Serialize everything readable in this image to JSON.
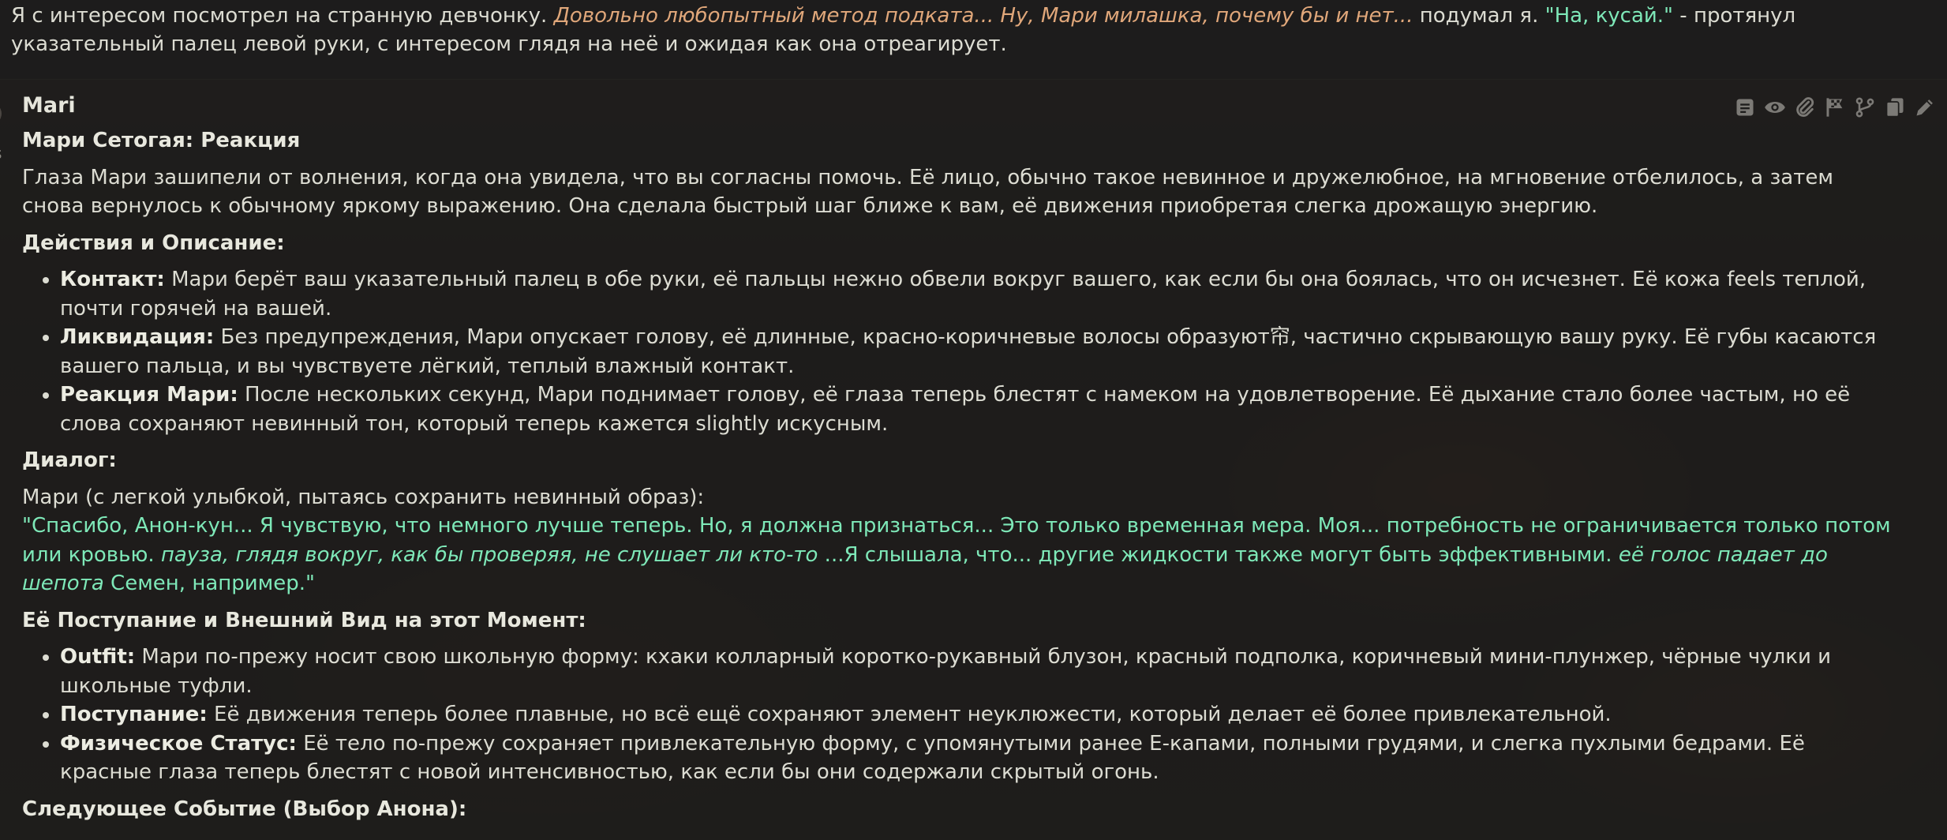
{
  "previous_message": {
    "part1": "Я с интересом посмотрел на странную девчонку. ",
    "thought": "Довольно любопытный метод подката... Ну, Мари милашка, почему бы и нет...",
    "part2": " подумал я. ",
    "quote": "\"На, кусай.\"",
    "part3": " - протянул указательный палец левой руки, с интересом глядя на неё и ожидая как она отреагирует."
  },
  "left_gutter": {
    "line1": "s",
    "line2": "t"
  },
  "message": {
    "character_name": "Mari",
    "title": "Мари Сетогая: Реакция",
    "intro": "Глаза Мари зашипели от волнения, когда она увидела, что вы согласны помочь. Её лицо, обычно такое невинное и дружелюбное, на мгновение отбелилось, а затем снова вернулось к обычному яркому выражению. Она сделала быстрый шаг ближе к вам, её движения приобретая слегка дрожащую энергию.",
    "section1_title": "Действия и Описание:",
    "actions": [
      {
        "label": "Контакт:",
        "text": " Мари берёт ваш указательный палец в обе руки, её пальцы нежно обвели вокруг вашего, как если бы она боялась, что он исчезнет. Её кожа feels теплой, почти горячей на вашей."
      },
      {
        "label": "Ликвидация:",
        "text": " Без предупреждения, Мари опускает голову, её длинные, красно-коричневые волосы образуют帘, частично скрывающую вашу руку. Её губы касаются вашего пальца, и вы чувствуете лёгкий, теплый влажный контакт."
      },
      {
        "label": "Реакция Мари:",
        "text": " После нескольких секунд, Мари поднимает голову, её глаза теперь блестят с намеком на удовлетворение. Её дыхание стало более частым, но её слова сохраняют невинный тон, который теперь кажется slightly искусным."
      }
    ],
    "section2_title": "Диалог:",
    "dialog_intro": "Мари (с легкой улыбкой, пытаясь сохранить невинный образ):",
    "dialog_part1": "\"Спасибо, Анон-кун... Я чувствую, что немного лучше теперь. Но, я должна признаться... Это только временная мера. Моя... потребность не ограничивается только потом или кровью. ",
    "dialog_italic1": "пауза, глядя вокруг, как бы проверяя, не слушает ли кто-то",
    "dialog_part2": " ...Я слышала, что... другие жидкости также могут быть эффективными. ",
    "dialog_italic2": "её голос падает до шепота",
    "dialog_part3": " Семен, например.\"",
    "section3_title": "Её Поступание и Внешний Вид на этот Момент:",
    "appearance": [
      {
        "label": "Outfit:",
        "text": " Мари по-прежу носит свою школьную форму: кхаки колларный коротко-рукавный блузон, красный подполка, коричневый мини-плунжер, чёрные чулки и школьные туфли."
      },
      {
        "label": "Поступание:",
        "text": " Её движения теперь более плавные, но всё ещё сохраняют элемент неуклюжести, который делает её более привлекательной."
      },
      {
        "label": "Физическое Статус:",
        "text": " Её тело по-прежу сохраняет привлекательную форму, с упомянутыми ранее E-капами, полными грудями, и слегка пухлыми бедрами. Её красные глаза теперь блестят с новой интенсивностью, как если бы они содержали скрытый огонь."
      }
    ],
    "section4_title": "Следующее Событие (Выбор Анона):"
  },
  "toolbar_icons": [
    "note-icon",
    "eye-icon",
    "paperclip-icon",
    "flag-icon",
    "branch-icon",
    "copy-icon",
    "pencil-icon"
  ],
  "colors": {
    "quote": "#7ee8b8",
    "thought": "#e0a77a",
    "text": "#dcdcd2"
  }
}
